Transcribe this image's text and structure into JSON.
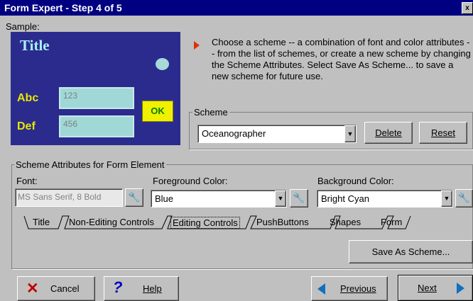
{
  "window": {
    "title": "Form Expert - Step 4 of 5",
    "close": "x"
  },
  "sample": {
    "label": "Sample:",
    "title": "Title",
    "abc_label": "Abc",
    "abc_value": "123",
    "def_label": "Def",
    "def_value": "456",
    "ok_label": "OK"
  },
  "instructions": "Choose a scheme -- a combination of font and color attributes -- from the list of schemes, or create a new scheme by changing the Scheme Attributes.  Select Save As Scheme... to save a new scheme for future use.",
  "scheme": {
    "group_label": "Scheme",
    "selected": "Oceanographer",
    "delete_label": "Delete",
    "reset_label": "Reset"
  },
  "attributes": {
    "group_label": "Scheme Attributes for Form Element",
    "font_label": "Font:",
    "font_value": "MS Sans Serif, 8 Bold",
    "fg_label": "Foreground Color:",
    "fg_value": "Blue",
    "bg_label": "Background Color:",
    "bg_value": "Bright Cyan",
    "tabs": [
      "Title",
      "Non-Editing Controls",
      "Editing Controls",
      "PushButtons",
      "Shapes",
      "Form"
    ],
    "active_tab": "Editing Controls",
    "save_as_label": "Save As Scheme..."
  },
  "buttons": {
    "cancel": "Cancel",
    "help": "Help",
    "previous": "Previous",
    "next": "Next"
  },
  "colors": {
    "titlebar": "#000080",
    "sample_bg": "#2b2b8e",
    "sample_accent": "#e8e800",
    "field_cyan": "#a0d8d8"
  }
}
